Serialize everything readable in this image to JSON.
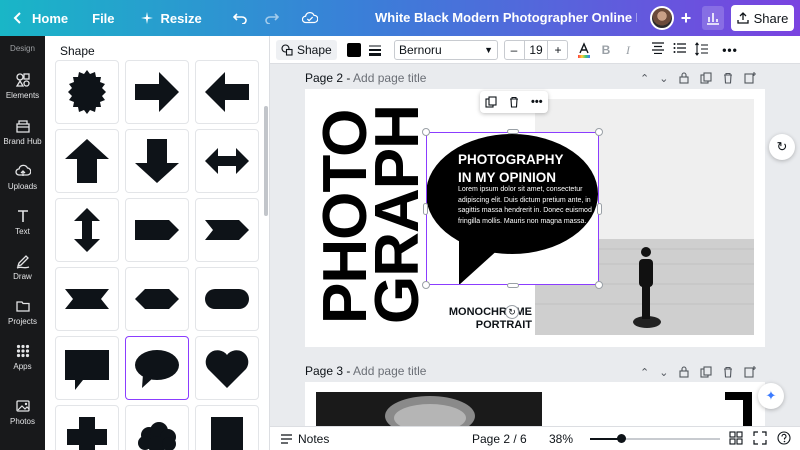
{
  "topbar": {
    "home_label": "Home",
    "file_label": "File",
    "resize_label": "Resize",
    "doc_title": "White Black Modern Photographer Online Portf...",
    "share_label": "Share"
  },
  "rail": {
    "section_label": "Design",
    "items": [
      {
        "label": "Elements",
        "icon": "elements-icon"
      },
      {
        "label": "Brand Hub",
        "icon": "brand-hub-icon"
      },
      {
        "label": "Uploads",
        "icon": "uploads-icon"
      },
      {
        "label": "Text",
        "icon": "text-icon"
      },
      {
        "label": "Draw",
        "icon": "draw-icon"
      },
      {
        "label": "Projects",
        "icon": "projects-icon"
      },
      {
        "label": "Apps",
        "icon": "apps-icon"
      },
      {
        "label": "Photos",
        "icon": "photos-icon"
      }
    ]
  },
  "panel": {
    "title": "Shape",
    "shapes": [
      "badge",
      "arrow-right",
      "arrow-left",
      "arrow-up",
      "arrow-down",
      "arrow-double-horizontal",
      "arrow-double-vertical",
      "pentagon-tag",
      "chevron",
      "ribbon",
      "hexagon-flat",
      "pill",
      "speech-rect",
      "speech-oval",
      "heart",
      "cross",
      "cloud",
      "rectangle"
    ],
    "selected_index": 13
  },
  "context_toolbar": {
    "shape_label": "Shape",
    "fill_color": "#000000",
    "font_name": "Bernoru",
    "font_size": "19",
    "minus": "–",
    "plus": "+"
  },
  "canvas": {
    "page2_label": "Page 2 -",
    "page2_placeholder": "Add page title",
    "page3_label": "Page 3 -",
    "page3_placeholder": "Add page title",
    "vertical_word_1": "PHOTO",
    "vertical_word_2": "GRAPH",
    "bubble_heading_1": "PHOTOGRAPHY",
    "bubble_heading_2": "IN MY OPINION",
    "bubble_body": "Lorem ipsum dolor sit amet, consectetur adipiscing elit. Duis dictum pretium ante, in sagittis massa hendrerit in. Donec euismod fringilla mollis. Mauris non magna massa.",
    "mono_line_1": "MONOCHROME",
    "mono_line_2": "PORTRAIT"
  },
  "bottom": {
    "notes_label": "Notes",
    "page_count": "Page 2 / 6",
    "zoom_label": "38%",
    "zoom_percent": 38
  },
  "colors": {
    "accent": "#8b3dff",
    "rail_bg": "#18191b"
  }
}
